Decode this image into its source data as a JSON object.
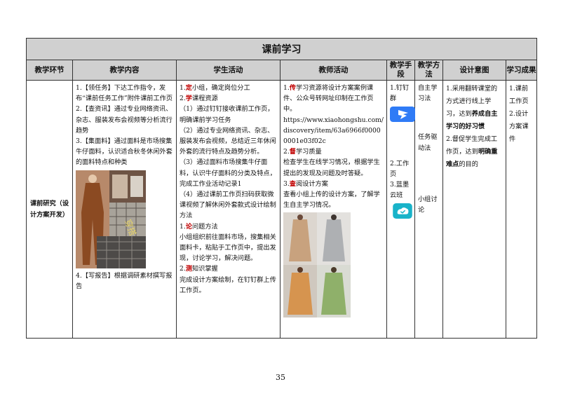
{
  "title": "课前学习",
  "headers": {
    "stage": "教学环节",
    "content": "教学内容",
    "student": "学生活动",
    "teacher": "教师活动",
    "means": "教学手段",
    "method": "教学方法",
    "intent": "设计意图",
    "outcome": "学习成果"
  },
  "stage_label": "课前研究（设计方案开发）",
  "content": {
    "p1": "1.【领任务】下达工作指令，发布“课前任务工作”附件课前工作页",
    "p2": "2.【查资讯】通过专业网络资讯、杂志、服装发布会视频等分析流行趋势",
    "p3": "3.【集面料】通过面料是市场搜集牛仔面料，认识适合秋冬休闲外套的面料特点和种类",
    "photo_text": "穿搭",
    "p4": "4.【写报告】根据调研素材撰写报告"
  },
  "student": {
    "l1_num": "1.",
    "l1_red": "定",
    "l1_rest": "小组，确定岗位分工",
    "l2_num": "2.",
    "l2_red": "学",
    "l2_rest": "课程资源",
    "l3": "（1）通过钉钉接收课前工作页，明确课前学习任务",
    "l4": "（2）通过专业网络资讯、杂志、服装发布会视频，总结近三年休闲外套的流行特点及趋势分析。",
    "l5": "（3）通过面料市场搜集牛仔面料，认识牛仔面料的分类及特点，完成工作业活动记录1",
    "l6": "（4）通过课前工作页扫码获取微课视频了解休闲外套款式设计绘制方法",
    "l7_num": "1.",
    "l7_red": "论",
    "l7_rest": "问题方法",
    "l8": "小组组织前往面料市场，搜集相关面料卡，粘贴于工作页中，提出发现，讨论学习，解决问题。",
    "l9_num": "2.",
    "l9_red": "测",
    "l9_rest": "知识掌握",
    "l10": "完成设计方案绘制，在钉钉群上传工作页。"
  },
  "teacher": {
    "l1_num": "1.",
    "l1_red": "传",
    "l1_rest": "学习资源将设计方案案例课件、公众号转网址印制在工作页中。",
    "url": "https://www.xiaohongshu.com/discovery/item/63a6966f00000001e03f02c",
    "l2_num": "2.",
    "l2_red": "督",
    "l2_rest": "学习质量",
    "l3": "检查学生在线学习情况，根据学生提出的发现及问题及时答疑。",
    "l4_num": "3.",
    "l4_red": "查",
    "l4_rest": "阅设计方案",
    "l5": "查看小组上传的设计方案，了解学生自主学习情况。"
  },
  "means": {
    "m1": "1.钉钉群",
    "m2": "2.工作页",
    "m3": "3.蓝墨云班"
  },
  "method": {
    "t1": "自主学习法",
    "t2": "任务驱动法",
    "t3": "小组讨论"
  },
  "intent": {
    "p1_a": "1.采用翻转课堂的方式进行线上学习，达到",
    "p1_b": "养成自主学习的好习惯",
    "p2_a": "2.督促学生完成工作页，达到",
    "p2_b": "明确重难点",
    "p2_c": "的目的"
  },
  "outcome": {
    "o1": "1.课前工作页",
    "o2": "2.设计方案课件"
  },
  "page_number": "35",
  "colors": {
    "header_bg": "#d0d0d0",
    "red_text": "#c00000",
    "dingtalk_icon": "#2f7bf6",
    "mosoteach_icon": "#19b3c9"
  }
}
